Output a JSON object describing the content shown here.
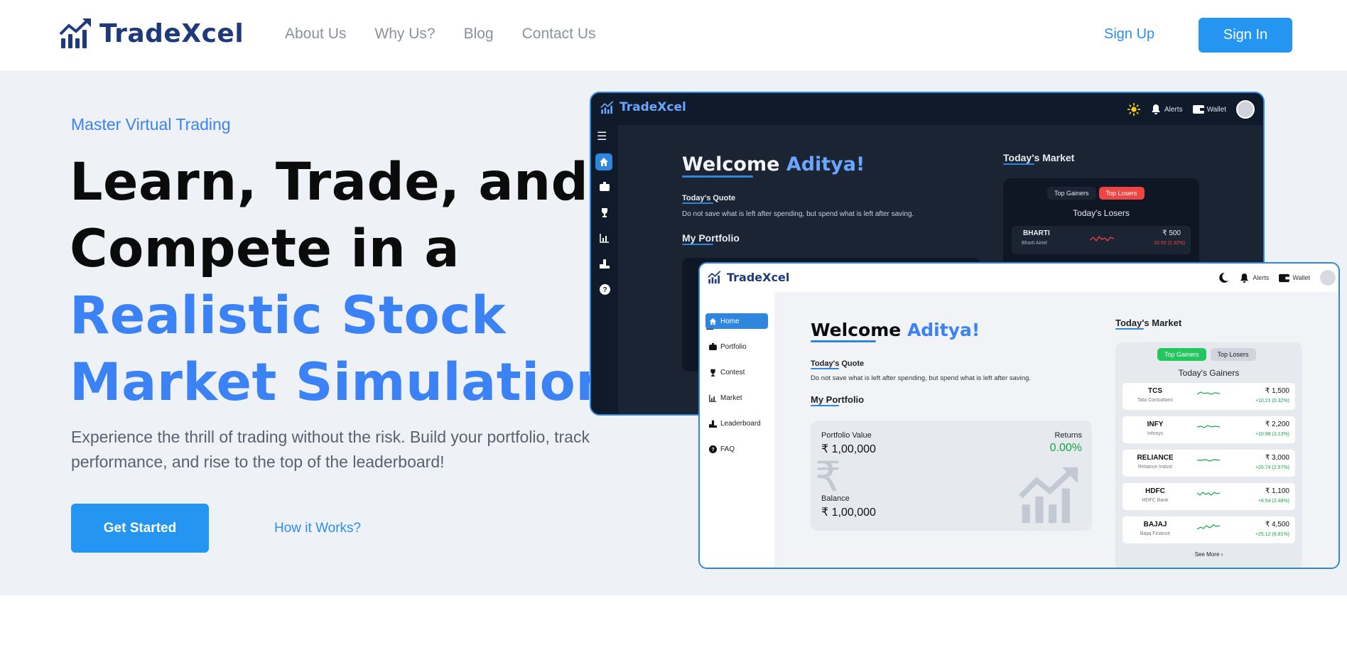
{
  "header": {
    "brand": "TradeXcel",
    "nav": [
      "About Us",
      "Why Us?",
      "Blog",
      "Contact Us"
    ],
    "signup": "Sign Up",
    "signin": "Sign In"
  },
  "hero": {
    "kicker": "Master Virtual Trading",
    "line1": "Learn, Trade, and",
    "line2": "Compete in a",
    "line3": "Realistic Stock",
    "line4": "Market Simulation",
    "subtext": "Experience the thrill of trading without the risk. Build your portfolio, track performance, and rise to the top of the leaderboard!",
    "get_started": "Get Started",
    "how_it_works": "How it Works?"
  },
  "dark_app": {
    "brand": "TradeXcel",
    "alerts": "Alerts",
    "wallet": "Wallet",
    "welcome": "Welcome",
    "name": "Aditya!",
    "quote_heading": "Today's Quote",
    "quote": "Do not save what is left after spending, but spend what is left after saving.",
    "portfolio_heading": "My Portfolio",
    "market_heading": "Today's Market",
    "tab_gainers": "Top Gainers",
    "tab_losers": "Top Losers",
    "losers_title": "Today's Losers",
    "row": {
      "symbol": "BHARTI",
      "name": "Bharti Airtel",
      "price": "₹ 500",
      "change": "10.50 (2.32%)"
    }
  },
  "light_app": {
    "brand": "TradeXcel",
    "alerts": "Alerts",
    "wallet": "Wallet",
    "sidebar": [
      "Home",
      "Portfolio",
      "Contest",
      "Market",
      "Leaderboard",
      "FAQ"
    ],
    "welcome": "Welcome",
    "name": "Aditya!",
    "quote_heading": "Today's Quote",
    "quote": "Do not save what is left after spending, but spend what is left after saving.",
    "portfolio_heading": "My Portfolio",
    "portfolio_value_label": "Portfolio Value",
    "portfolio_value": "₹ 1,00,000",
    "returns_label": "Returns",
    "returns": "0.00%",
    "balance_label": "Balance",
    "balance": "₹ 1,00,000",
    "market_heading": "Today's Market",
    "tab_gainers": "Top Gainers",
    "tab_losers": "Top Losers",
    "gainers_title": "Today's Gainers",
    "stocks": [
      {
        "symbol": "TCS",
        "name": "Tata Consultanc",
        "price": "₹ 1,500",
        "change": "+10.21 (0.32%)"
      },
      {
        "symbol": "INFY",
        "name": "Infosys",
        "price": "₹ 2,200",
        "change": "+10.98 (3.13%)"
      },
      {
        "symbol": "RELIANCE",
        "name": "Reliance Indust",
        "price": "₹ 3,000",
        "change": "+20.74 (2.57%)"
      },
      {
        "symbol": "HDFC",
        "name": "HDFC Bank",
        "price": "₹ 1,100",
        "change": "+8.54 (2.49%)"
      },
      {
        "symbol": "BAJAJ",
        "name": "Bajaj Finance",
        "price": "₹ 4,500",
        "change": "+25.12 (6.81%)"
      }
    ],
    "see_more": "See More ›"
  },
  "colors": {
    "brand_blue": "#2495f0",
    "accent": "#3b82f6",
    "logo_navy": "#1f3a7a",
    "gain_green": "#16a34a",
    "loss_red": "#ef4444"
  }
}
